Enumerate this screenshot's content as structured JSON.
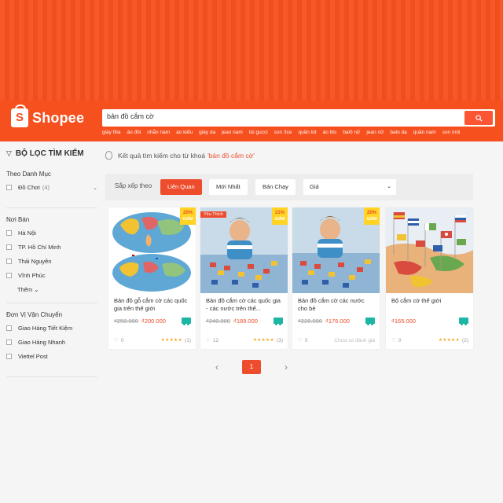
{
  "header": {
    "logo_text": "Shopee",
    "logo_glyph": "S",
    "search_value": "bản đồ cắm cờ",
    "search_icon": "search-icon",
    "suggestions": [
      "giày filia",
      "áo đôi",
      "nhẫn nam",
      "áo kiểu",
      "giày da",
      "jean nam",
      "túi gucci",
      "son 3ce",
      "quần lót",
      "áo bts",
      "balô nữ",
      "jean nữ",
      "balo da",
      "quần nam",
      "son môi"
    ]
  },
  "sidebar": {
    "filter_title": "BỘ LỌC TÌM KIẾM",
    "category": {
      "title": "Theo Danh Mục",
      "items": [
        {
          "label": "Đồ Chơi",
          "count": "(4)"
        }
      ]
    },
    "location": {
      "title": "Nơi Bán",
      "items": [
        "Hà Nội",
        "TP. Hồ Chí Minh",
        "Thái Nguyên",
        "Vĩnh Phúc"
      ],
      "more": "Thêm"
    },
    "shipping": {
      "title": "Đơn Vị Vận Chuyển",
      "items": [
        "Giao Hàng Tiết Kiệm",
        "Giao Hàng Nhanh",
        "Viettel Post"
      ]
    }
  },
  "results": {
    "prefix": "Kết quả tìm kiếm cho từ khoá",
    "keyword": "'bản đồ cắm cờ'"
  },
  "sort": {
    "label": "Sắp xếp theo",
    "options": [
      "Liên Quan",
      "Mới Nhất",
      "Bán Chạy"
    ],
    "active_index": 0,
    "price_label": "Giá"
  },
  "products": [
    {
      "title": "Bản đồ gỗ cắm cờ các quốc gia trên thế giới",
      "old_price": "₫250.000",
      "price": "₫200.000",
      "discount": "20%",
      "discount_label": "GIẢM",
      "likes": "0",
      "rating": "5",
      "reviews": "(1)",
      "stars": "★★★★★"
    },
    {
      "title": "Bản đồ cắm cờ các quốc gia - các nước trên thế...",
      "old_price": "₫240.000",
      "price": "₫189.000",
      "discount": "21%",
      "discount_label": "GIẢM",
      "badge": "Yêu Thích",
      "likes": "12",
      "rating": "4",
      "reviews": "(3)",
      "stars": "★★★★★"
    },
    {
      "title": "Bản đồ cắm cờ các nước cho bé",
      "old_price": "₫220.000",
      "price": "₫176.000",
      "discount": "20%",
      "discount_label": "GIẢM",
      "likes": "0",
      "no_rating": "Chưa có đánh giá"
    },
    {
      "title": "Bộ cắm cờ thế giới",
      "price": "₫165.000",
      "likes": "0",
      "rating": "5",
      "reviews": "(2)",
      "stars": "★★★★★"
    }
  ],
  "pagination": {
    "current": "1"
  },
  "colors": {
    "brand": "#ee4d2d",
    "header": "#f6501e",
    "discount_bg": "#ffd424",
    "shipping": "#1db5a4"
  }
}
